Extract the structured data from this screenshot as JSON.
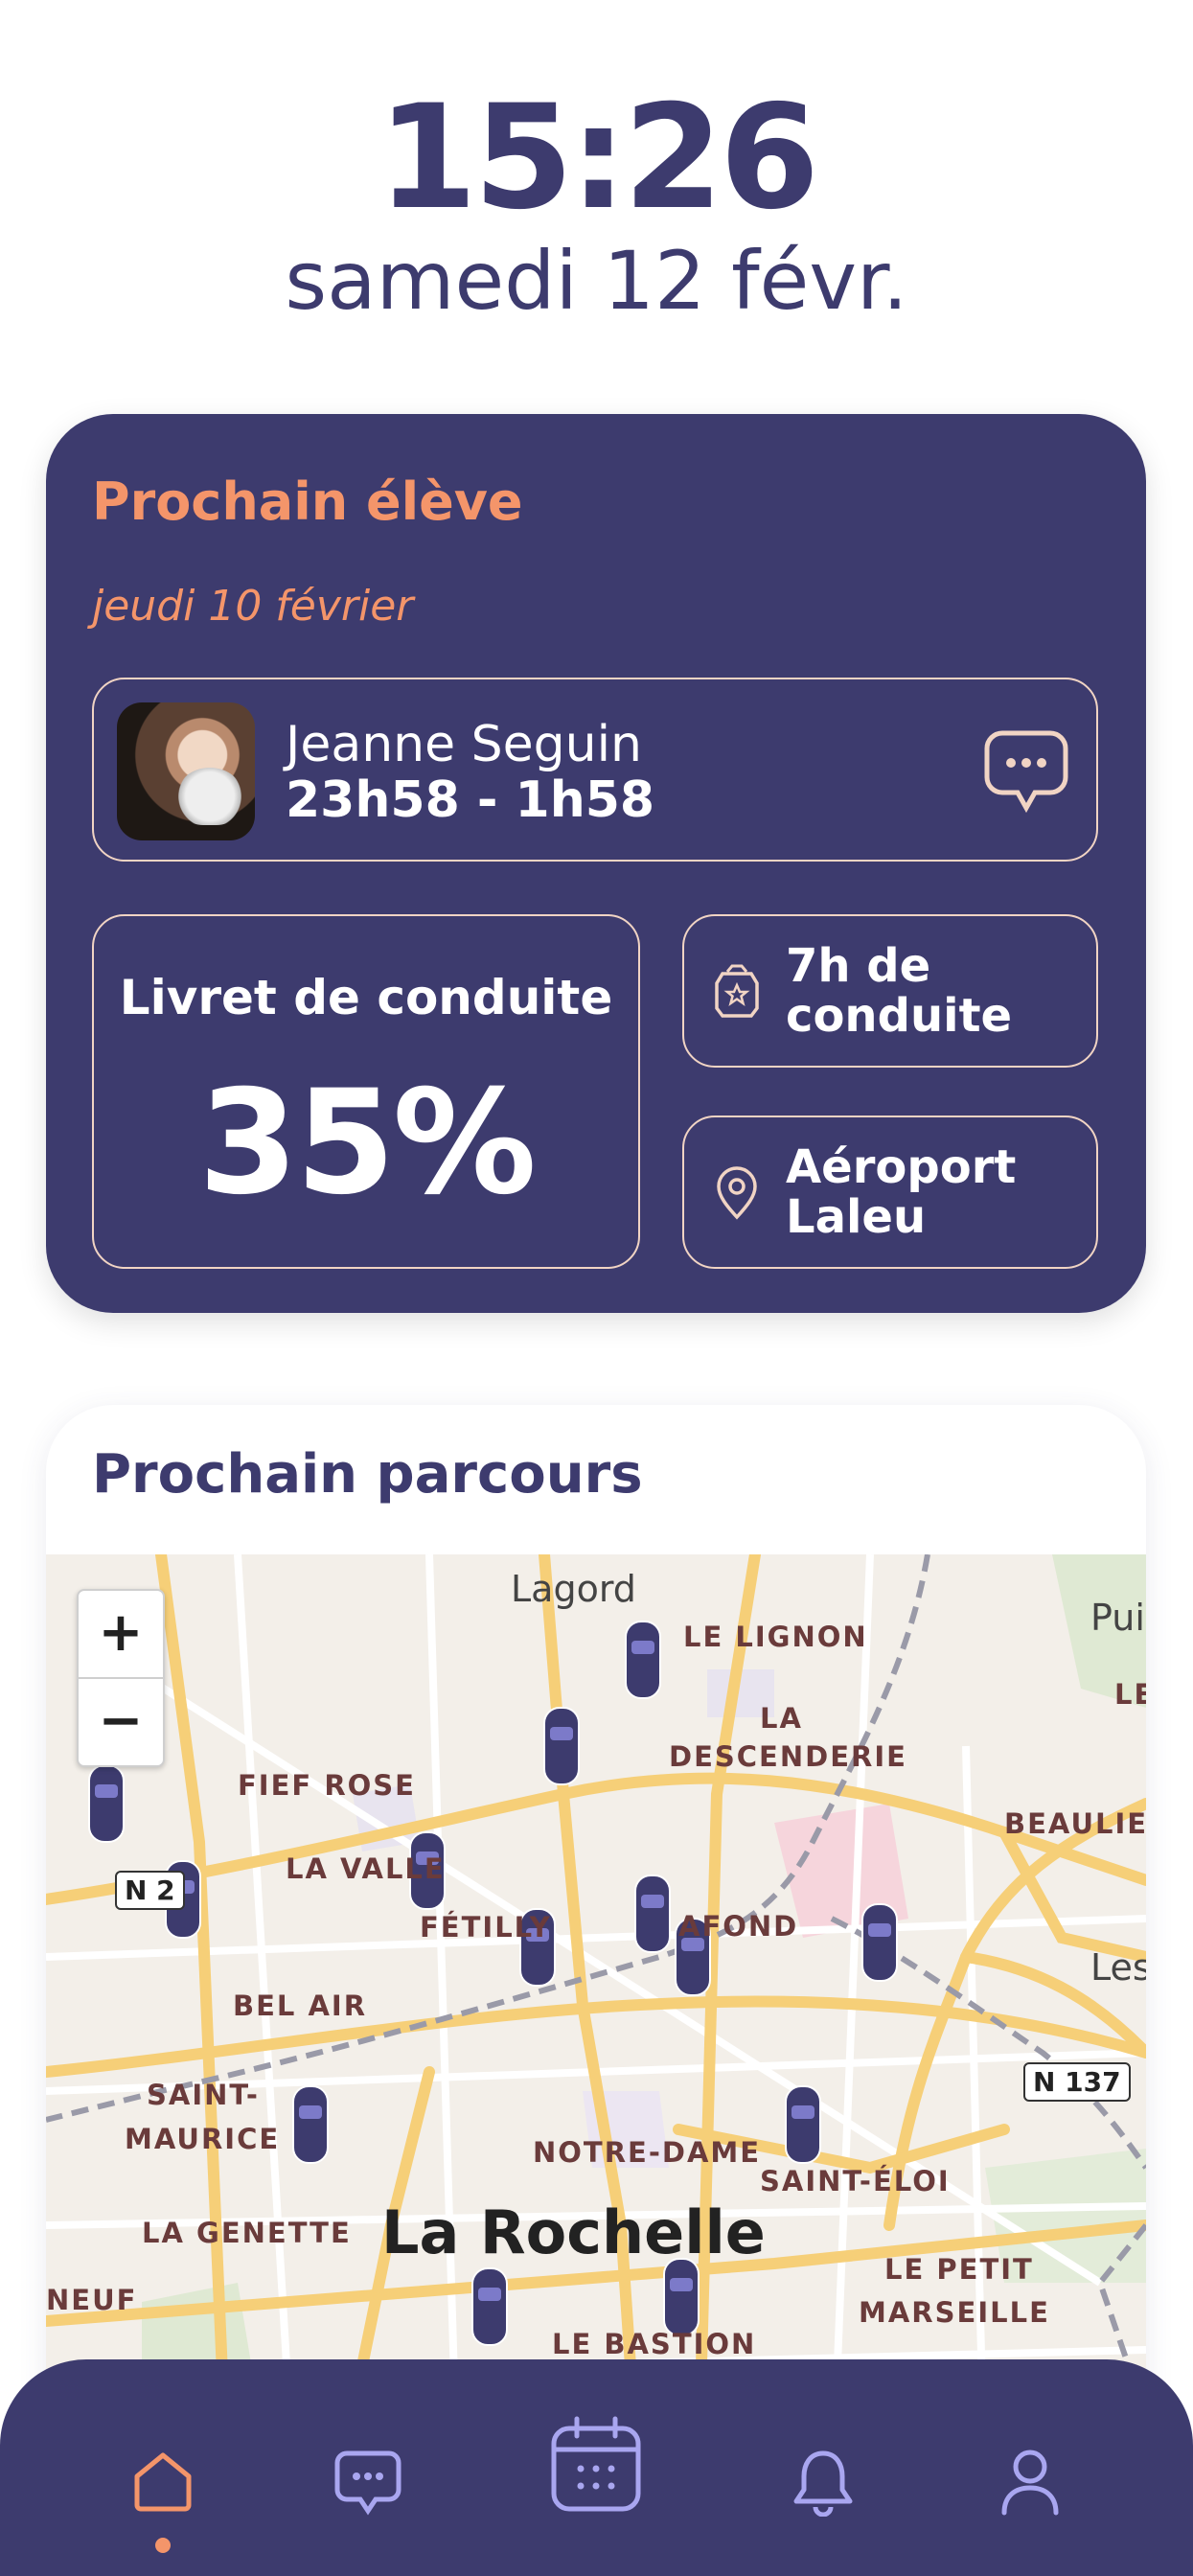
{
  "clock": {
    "time": "15:26",
    "date": "samedi 12 févr."
  },
  "next_student": {
    "title": "Prochain élève",
    "date": "jeudi 10 février",
    "name": "Jeanne Seguin",
    "time_range": "23h58 - 1h58",
    "chat_icon": "chat-bubble-icon",
    "livret_label": "Livret de conduite",
    "livret_progress": "35%",
    "hours_label_1": "7h de",
    "hours_label_2": "conduite",
    "place_label_1": "Aéroport",
    "place_label_2": "Laleu"
  },
  "route": {
    "title": "Prochain parcours",
    "zoom_in": "+",
    "zoom_out": "−",
    "labels": {
      "lagord": "Lagord",
      "le_lignon": "LE LIGNON",
      "pui": "Pui",
      "le": "LE",
      "la_desc_1": "LA",
      "la_desc_2": "DESCENDERIE",
      "fief_rose": "FIEF ROSE",
      "beaulieu": "BEAULIEU",
      "la_valle": "LA VALLE",
      "n2": "N 2",
      "fetilly": "FÉTILLY",
      "lafond": "AFOND",
      "les": "Les",
      "bel_air": "BEL AIR",
      "saint_maurice_1": "SAINT-",
      "saint_maurice_2": "MAURICE",
      "n137": "N 137",
      "notre_dame": "NOTRE-DAME",
      "saint_eloi": "SAINT-ÉLOI",
      "la_genette": "LA GENETTE",
      "la_rochelle": "La Rochelle",
      "le_petit": "LE PETIT",
      "marseille": "MARSEILLE",
      "neuf": "NEUF",
      "le_bastion": "LE BASTION"
    }
  },
  "tabbar": {
    "items": [
      "home-icon",
      "messages-icon",
      "calendar-icon",
      "notifications-icon",
      "profile-icon"
    ],
    "active": "home-icon",
    "accent": "#f4956a",
    "inactive": "#a9a6f0"
  },
  "colors": {
    "primary": "#3d3b6e",
    "accent": "#f4956a",
    "border": "#f1d4c4"
  }
}
